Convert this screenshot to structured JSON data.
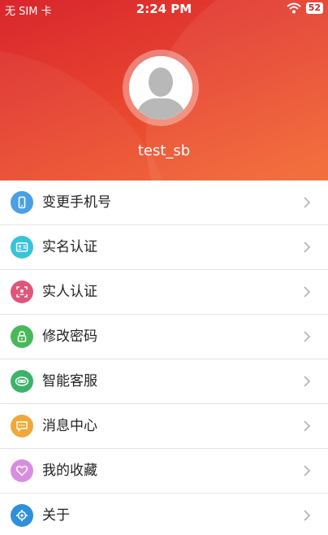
{
  "status_bar": {
    "carrier": "无 SIM 卡",
    "time": "2:24 PM",
    "battery": "52"
  },
  "profile": {
    "username": "test_sb"
  },
  "menu": [
    {
      "label": "变更手机号",
      "icon": "phone-icon",
      "color": "#4a9fe6"
    },
    {
      "label": "实名认证",
      "icon": "id-card-icon",
      "color": "#38c3d8"
    },
    {
      "label": "实人认证",
      "icon": "face-scan-icon",
      "color": "#e0557a"
    },
    {
      "label": "修改密码",
      "icon": "lock-icon",
      "color": "#48b95a"
    },
    {
      "label": "智能客服",
      "icon": "robot-icon",
      "color": "#3bb36a"
    },
    {
      "label": "消息中心",
      "icon": "message-icon",
      "color": "#f0a838"
    },
    {
      "label": "我的收藏",
      "icon": "heart-icon",
      "color": "#d98de0"
    },
    {
      "label": "关于",
      "icon": "gear-icon",
      "color": "#2f8fd9"
    }
  ],
  "colors": {
    "header_start": "#d9262e",
    "header_end": "#f3672f"
  }
}
